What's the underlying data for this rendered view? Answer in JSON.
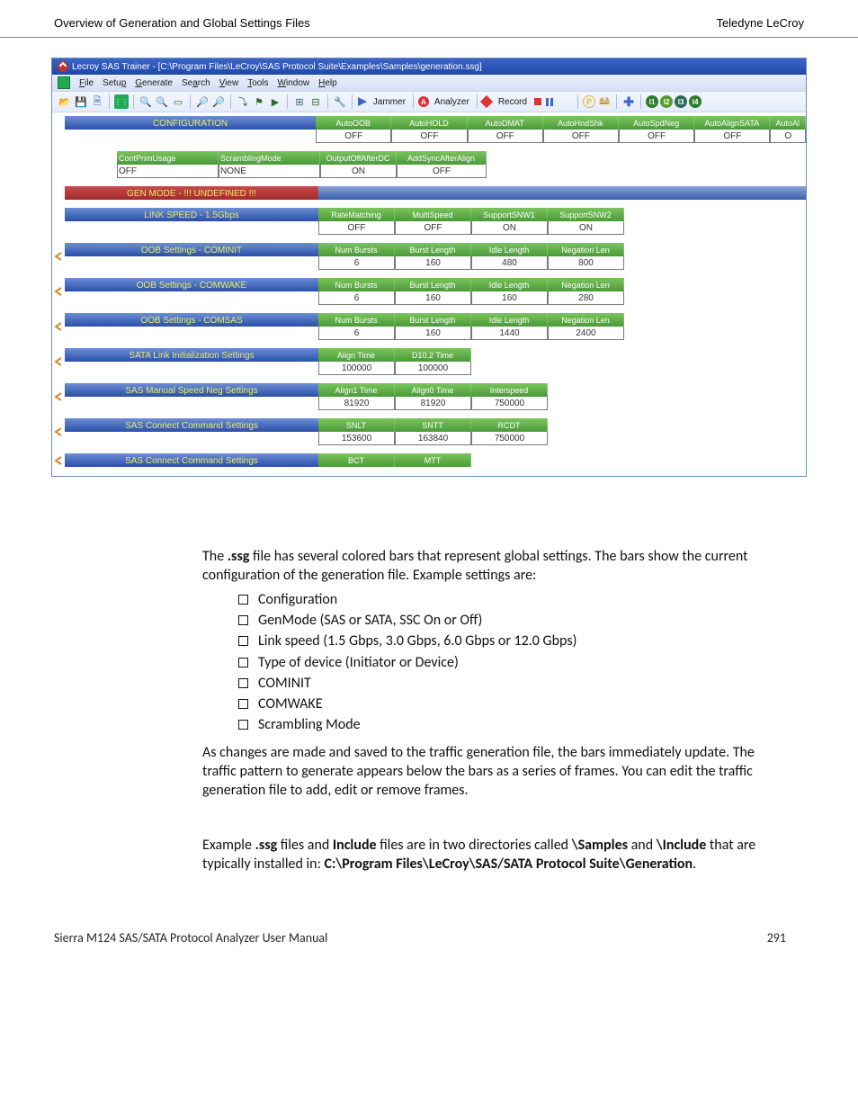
{
  "header": {
    "left": "Overview of Generation and Global Settings Files",
    "right": "Teledyne LeCroy"
  },
  "app": {
    "title": "Lecroy SAS Trainer - [C:\\Program Files\\LeCroy\\SAS Protocol Suite\\Examples\\Samples\\generation.ssg]",
    "menus": [
      "File",
      "Setup",
      "Generate",
      "Search",
      "View",
      "Tools",
      "Window",
      "Help"
    ],
    "toolbar": {
      "jammer": "Jammer",
      "analyzer": "Analyzer",
      "record": "Record"
    },
    "rows": {
      "config": {
        "label": "CONFIGURATION",
        "cells": [
          {
            "h": "AutoOOB",
            "v": "OFF"
          },
          {
            "h": "AutoHOLD",
            "v": "OFF"
          },
          {
            "h": "AutoDMAT",
            "v": "OFF"
          },
          {
            "h": "AutoHndShk",
            "v": "OFF"
          },
          {
            "h": "AutoSpdNeg",
            "v": "OFF"
          },
          {
            "h": "AutoAlignSATA",
            "v": "OFF"
          },
          {
            "h": "AutoAl",
            "v": "O"
          }
        ]
      },
      "contprim": {
        "left": {
          "h": "ContPrimUsage",
          "v": "OFF"
        },
        "right": {
          "h": "ScramblingMode",
          "v": "NONE"
        },
        "cells": [
          {
            "h": "OutputOffAfterDC",
            "v": "ON"
          },
          {
            "h": "AddSyncAfterAlign",
            "v": "OFF"
          }
        ]
      },
      "genmode": {
        "label": "GEN MODE - !!! UNDEFINED !!!"
      },
      "linkspeed": {
        "label": "LINK SPEED  -  1.5Gbps",
        "cells": [
          {
            "h": "RateMatching",
            "v": "OFF"
          },
          {
            "h": "MultiSpeed",
            "v": "OFF"
          },
          {
            "h": "SupportSNW1",
            "v": "ON"
          },
          {
            "h": "SupportSNW2",
            "v": "ON"
          }
        ]
      },
      "cominit": {
        "label": "OOB Settings - COMINIT",
        "cells": [
          {
            "h": "Num Bursts",
            "v": "6"
          },
          {
            "h": "Burst Length",
            "v": "160"
          },
          {
            "h": "Idle Length",
            "v": "480"
          },
          {
            "h": "Negation Len",
            "v": "800"
          }
        ]
      },
      "comwake": {
        "label": "OOB Settings - COMWAKE",
        "cells": [
          {
            "h": "Num Bursts",
            "v": "6"
          },
          {
            "h": "Burst Length",
            "v": "160"
          },
          {
            "h": "Idle Length",
            "v": "160"
          },
          {
            "h": "Negation Len",
            "v": "280"
          }
        ]
      },
      "comsas": {
        "label": "OOB Settings - COMSAS",
        "cells": [
          {
            "h": "Num Bursts",
            "v": "6"
          },
          {
            "h": "Burst Length",
            "v": "160"
          },
          {
            "h": "Idle Length",
            "v": "1440"
          },
          {
            "h": "Negation Len",
            "v": "2400"
          }
        ]
      },
      "satalink": {
        "label": "SATA Link Initialization Settings",
        "cells": [
          {
            "h": "Align Time",
            "v": "100000"
          },
          {
            "h": "D10.2 Time",
            "v": "100000"
          }
        ]
      },
      "sasmanual": {
        "label": "SAS Manual Speed Neg Settings",
        "cells": [
          {
            "h": "Align1 Time",
            "v": "81920"
          },
          {
            "h": "Align0 Time",
            "v": "81920"
          },
          {
            "h": "Interspeed",
            "v": "750000"
          }
        ]
      },
      "sasconn1": {
        "label": "SAS Connect Command Settings",
        "cells": [
          {
            "h": "SNLT",
            "v": "153600"
          },
          {
            "h": "SNTT",
            "v": "163840"
          },
          {
            "h": "RCDT",
            "v": "750000"
          }
        ]
      },
      "sasconn2": {
        "label": "SAS Connect Command Settings",
        "cells": [
          {
            "h": "BCT"
          },
          {
            "h": "MTT"
          }
        ]
      }
    }
  },
  "body": {
    "p1a": "The ",
    "p1b": ".ssg",
    "p1c": " file has several colored bars that represent global settings. The bars show the current configuration of the generation file. Example settings are:",
    "bullets": [
      "Configuration",
      "GenMode (SAS or SATA, SSC On or Off)",
      "Link speed (1.5 Gbps, 3.0 Gbps, 6.0 Gbps or 12.0 Gbps)",
      "Type of device (Initiator or Device)",
      "COMINIT",
      "COMWAKE",
      "Scrambling Mode"
    ],
    "p2": "As changes are made and saved to the traffic generation file, the bars immediately update. The traffic pattern to generate appears below the bars as a series of frames. You can edit the traffic generation file to add, edit or remove frames.",
    "p3_parts": [
      "Example ",
      ".ssg",
      " files and ",
      "Include",
      " files are in two directories called ",
      "\\Samples",
      " and ",
      "\\Include",
      " that are typically installed in: ",
      "C:\\Program Files\\LeCroy\\SAS/SATA Protocol Suite\\Generation",
      "."
    ]
  },
  "footer": {
    "left": "Sierra M124 SAS/SATA Protocol Analyzer User Manual",
    "right": "291"
  }
}
